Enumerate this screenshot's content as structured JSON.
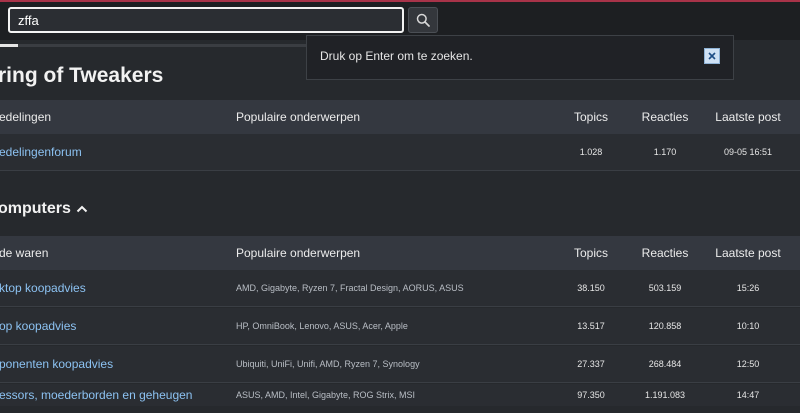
{
  "search": {
    "value": "zffa"
  },
  "progress": {
    "fraction": 0.023
  },
  "popup": {
    "message": "Druk op Enter om te zoeken."
  },
  "page_title": "ring of Tweakers",
  "section_computers": {
    "title": "omputers"
  },
  "table_mededelingen": {
    "headers": [
      "edelingen",
      "Populaire onderwerpen",
      "Topics",
      "Reacties",
      "Laatste post"
    ],
    "rows": [
      {
        "forum": "edelingenforum",
        "topics": "",
        "count": "1.028",
        "reacties": "1.170",
        "laatste": "09-05 16:51"
      }
    ]
  },
  "table_computers": {
    "headers": [
      "de waren",
      "Populaire onderwerpen",
      "Topics",
      "Reacties",
      "Laatste post"
    ],
    "rows": [
      {
        "forum": "ktop koopadvies",
        "topics": "AMD, Gigabyte, Ryzen 7, Fractal Design, AORUS, ASUS",
        "count": "38.150",
        "reacties": "503.159",
        "laatste": "15:26"
      },
      {
        "forum": "op koopadvies",
        "topics": "HP, OmniBook, Lenovo, ASUS, Acer, Apple",
        "count": "13.517",
        "reacties": "120.858",
        "laatste": "10:10"
      },
      {
        "forum": "ponenten koopadvies",
        "topics": "Ubiquiti, UniFi, Unifi, AMD, Ryzen 7, Synology",
        "count": "27.337",
        "reacties": "268.484",
        "laatste": "12:50"
      },
      {
        "forum": "essors, moederborden en geheugen",
        "topics": "ASUS, AMD, Intel, Gigabyte, ROG Strix, MSI",
        "count": "97.350",
        "reacties": "1.191.083",
        "laatste": "14:47"
      }
    ]
  },
  "colors": {
    "accent": "#a83349",
    "link": "#8cc2f2",
    "background": "#26292d"
  },
  "icons": {
    "search": "search-icon",
    "close": "close-icon",
    "collapse": "chevron-up-icon"
  }
}
